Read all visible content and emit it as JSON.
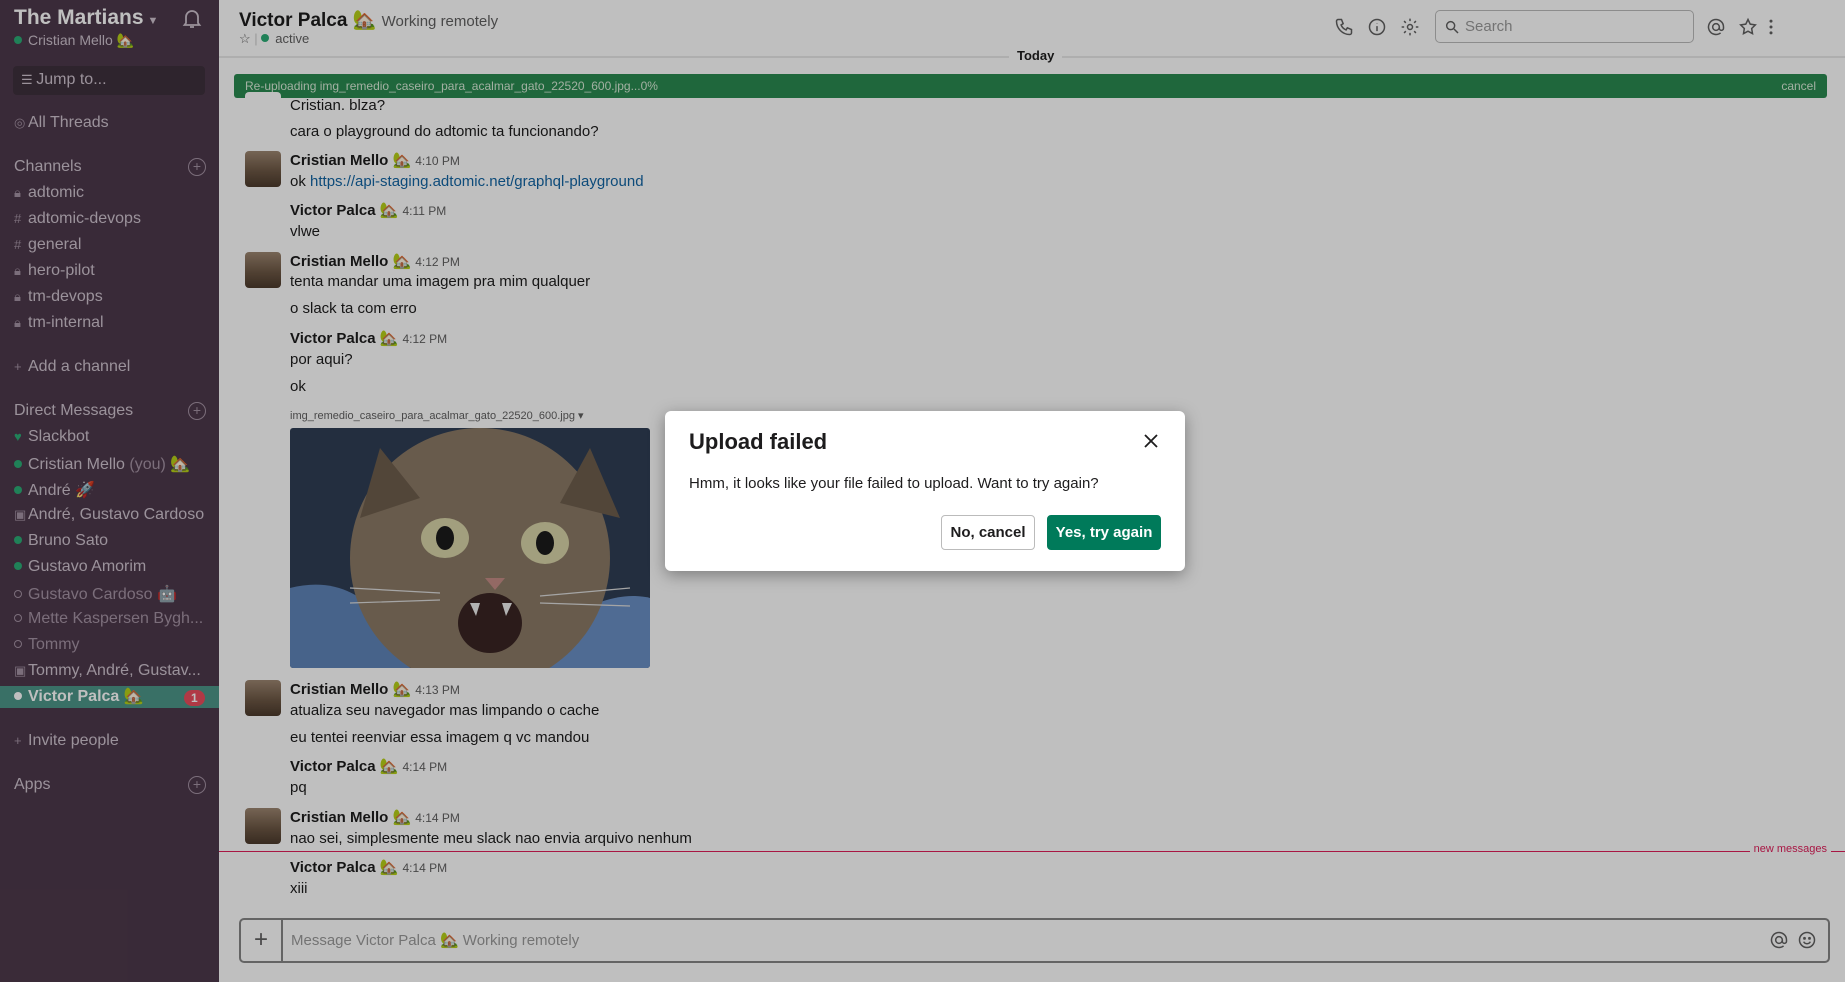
{
  "workspace": {
    "name": "The Martians",
    "user": "Cristian Mello 🏡",
    "jump_placeholder": "Jump to...",
    "all_threads": "All Threads"
  },
  "sidebar": {
    "channels_header": "Channels",
    "channels": [
      {
        "name": "adtomic",
        "prefix": "lock"
      },
      {
        "name": "adtomic-devops",
        "prefix": "hash"
      },
      {
        "name": "general",
        "prefix": "hash"
      },
      {
        "name": "hero-pilot",
        "prefix": "lock"
      },
      {
        "name": "tm-devops",
        "prefix": "lock"
      },
      {
        "name": "tm-internal",
        "prefix": "lock"
      }
    ],
    "add_channel": "Add a channel",
    "dm_header": "Direct Messages",
    "dms": [
      {
        "name": "Slackbot",
        "status": "heart"
      },
      {
        "name": "Cristian Mello",
        "suffix": "(you) 🏡",
        "status": "online"
      },
      {
        "name": "André",
        "suffix": "🚀",
        "status": "online"
      },
      {
        "name": "André, Gustavo Cardoso",
        "status": "group"
      },
      {
        "name": "Bruno Sato",
        "status": "online"
      },
      {
        "name": "Gustavo Amorim",
        "status": "online"
      },
      {
        "name": "Gustavo Cardoso",
        "suffix": "🤖",
        "status": "away"
      },
      {
        "name": "Mette Kaspersen Bygh...",
        "status": "away"
      },
      {
        "name": "Tommy",
        "status": "away"
      },
      {
        "name": "Tommy, André, Gustav...",
        "status": "group"
      },
      {
        "name": "Victor Palca",
        "suffix": "🏡",
        "status": "online",
        "active": true,
        "badge": "1"
      }
    ],
    "invite": "Invite people",
    "apps_header": "Apps"
  },
  "header": {
    "title": "Victor Palca 🏡",
    "status": "Working remotely",
    "presence": "active",
    "search_placeholder": "Search"
  },
  "messages": {
    "date_divider": "Today",
    "upload_progress": "Re-uploading img_remedio_caseiro_para_acalmar_gato_22520_600.jpg...0%",
    "upload_cancel": "cancel",
    "first_lines": [
      "Cristian. blza?",
      "cara o playground do adtomic ta funcionando?"
    ],
    "items": [
      {
        "author": "Cristian Mello 🏡",
        "time": "4:10 PM",
        "lines": [
          "ok "
        ],
        "link": "https://api-staging.adtomic.net/graphql-playground"
      },
      {
        "author": "Victor Palca 🏡",
        "time": "4:11 PM",
        "lines": [
          "vlwe"
        ]
      },
      {
        "author": "Cristian Mello 🏡",
        "time": "4:12 PM",
        "lines": [
          "tenta mandar uma imagem pra mim qualquer",
          "o slack ta com erro"
        ]
      },
      {
        "author": "Victor Palca 🏡",
        "time": "4:12 PM",
        "lines": [
          "por aqui?",
          "ok"
        ]
      },
      {
        "author": "Cristian Mello 🏡",
        "time": "4:13 PM",
        "lines": [
          "atualiza seu navegador mas limpando o cache",
          "eu tentei reenviar essa imagem q vc mandou"
        ]
      },
      {
        "author": "Victor Palca 🏡",
        "time": "4:14 PM",
        "lines": [
          "pq"
        ]
      },
      {
        "author": "Cristian Mello 🏡",
        "time": "4:14 PM",
        "lines": [
          "nao sei, simplesmente meu slack nao envia arquivo nenhum"
        ]
      },
      {
        "author": "Victor Palca 🏡",
        "time": "4:14 PM",
        "lines": [
          "xiii"
        ]
      }
    ],
    "file_name": "img_remedio_caseiro_para_acalmar_gato_22520_600.jpg",
    "new_messages": "new messages"
  },
  "composer": {
    "placeholder": "Message Victor Palca 🏡 Working remotely"
  },
  "modal": {
    "title": "Upload failed",
    "body": "Hmm, it looks like your file failed to upload. Want to try again?",
    "cancel_label": "No, cancel",
    "retry_label": "Yes, try again"
  },
  "colors": {
    "sidebar_bg": "#4d394b",
    "active_item": "#4c9689",
    "primary_button": "#007a5a",
    "badge": "#eb4d5c"
  }
}
